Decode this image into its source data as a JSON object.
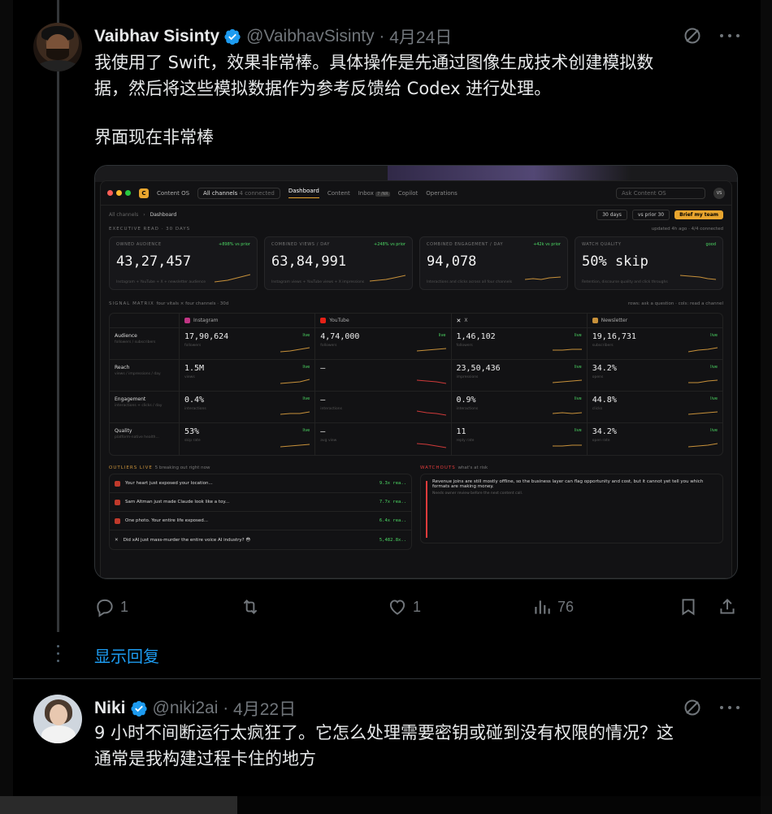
{
  "tweet1": {
    "name": "Vaibhav Sisinty",
    "handle": "@VaibhavSisinty",
    "date": "4月24日",
    "line1": "我使用了 Swift，效果非常棒。具体操作是先通过图像生成技术创建模拟数",
    "line2": "据，然后将这些模拟数据作为参考反馈给 Codex 进行处理。",
    "line3": "界面现在非常棒",
    "replies": "1",
    "likes": "1",
    "views": "76"
  },
  "show_replies": "显示回复",
  "tweet2": {
    "name": "Niki",
    "handle": "@niki2ai",
    "date": "4月22日",
    "line1": "9 小时不间断运行太疯狂了。它怎么处理需要密钥或碰到没有权限的情况？这",
    "line2": "通常是我构建过程卡住的地方"
  },
  "screenshot": {
    "app_name": "Content OS",
    "channels": "All channels",
    "connected": "4 connected",
    "tabs": [
      "Dashboard",
      "Content",
      "Inbox",
      "Copilot",
      "Operations"
    ],
    "inbox_badge": "7 /NR",
    "search": "Ask Content OS",
    "user_initials": "VS",
    "crumb1": "All channels",
    "crumb2": "Dashboard",
    "range": "30 days",
    "compare": "vs prior 30",
    "brief": "Brief my team",
    "exec_title": "EXECUTIVE READ · 30 DAYS",
    "exec_right": "updated 4h ago · 4/4 connected",
    "cards": [
      {
        "label": "OWNED AUDIENCE",
        "delta": "+898% vs prior",
        "value": "43,27,457",
        "sub": "Instagram + YouTube + X + newsletter audience"
      },
      {
        "label": "COMBINED VIEWS / DAY",
        "delta": "+248% vs prior",
        "value": "63,84,991",
        "sub": "Instagram views + YouTube views + X impressions"
      },
      {
        "label": "COMBINED ENGAGEMENT / DAY",
        "delta": "+42k vs prior",
        "value": "94,078",
        "sub": "Interactions and clicks across all four channels"
      },
      {
        "label": "WATCH QUALITY",
        "delta": "good",
        "value": "50% skip",
        "sub": "Retention, discourse quality and click throughs"
      }
    ],
    "matrix_title": "SIGNAL MATRIX",
    "matrix_sub": "four vitals × four channels · 30d",
    "matrix_right": "rows: ask a question · cols: read a channel",
    "channels_list": [
      "Instagram",
      "YouTube",
      "X",
      "Newsletter"
    ],
    "rows": [
      {
        "name": "Audience",
        "sub": "followers / subscribers",
        "vals": [
          "17,90,624",
          "4,74,000",
          "1,46,102",
          "19,16,731"
        ],
        "units": [
          "followers",
          "followers",
          "followers",
          "subscribers"
        ]
      },
      {
        "name": "Reach",
        "sub": "views / impressions / day",
        "vals": [
          "1.5M",
          "—",
          "23,50,436",
          "34.2%"
        ],
        "units": [
          "views",
          "",
          "impressions",
          "opens"
        ]
      },
      {
        "name": "Engagement",
        "sub": "interactions + clicks / day",
        "vals": [
          "0.4%",
          "—",
          "0.9%",
          "44.8%"
        ],
        "units": [
          "interactions",
          "interactions",
          "interactions",
          "clicks"
        ]
      },
      {
        "name": "Quality",
        "sub": "platform-native health...",
        "vals": [
          "53%",
          "—",
          "11",
          "34.2%"
        ],
        "units": [
          "skip rate",
          "avg view",
          "reply rate",
          "open rate"
        ]
      }
    ],
    "live": "live",
    "outliers_title": "OUTLIERS LIVE",
    "outliers_sub": "5 breaking out right now",
    "outliers": [
      {
        "text": "Your heart just exposed your location...",
        "stat": "9.3x rea.."
      },
      {
        "text": "Sam Altman just made Claude look like a toy...",
        "stat": "7.7x rea.."
      },
      {
        "text": "One photo. Your entire life exposed...",
        "stat": "6.4x rea.."
      },
      {
        "text": "Did xAI just mass-murder the entire voice AI industry? 😳",
        "stat": "5,482.8x.."
      }
    ],
    "watch_title": "WATCHOUTS",
    "watch_sub": "what's at risk",
    "watch_text": "Revenue joins are still mostly offline, so the business layer can flag opportunity and cost, but it cannot yet tell you which formats are making money.",
    "watch_small": "Needs owner review before the next content call."
  }
}
